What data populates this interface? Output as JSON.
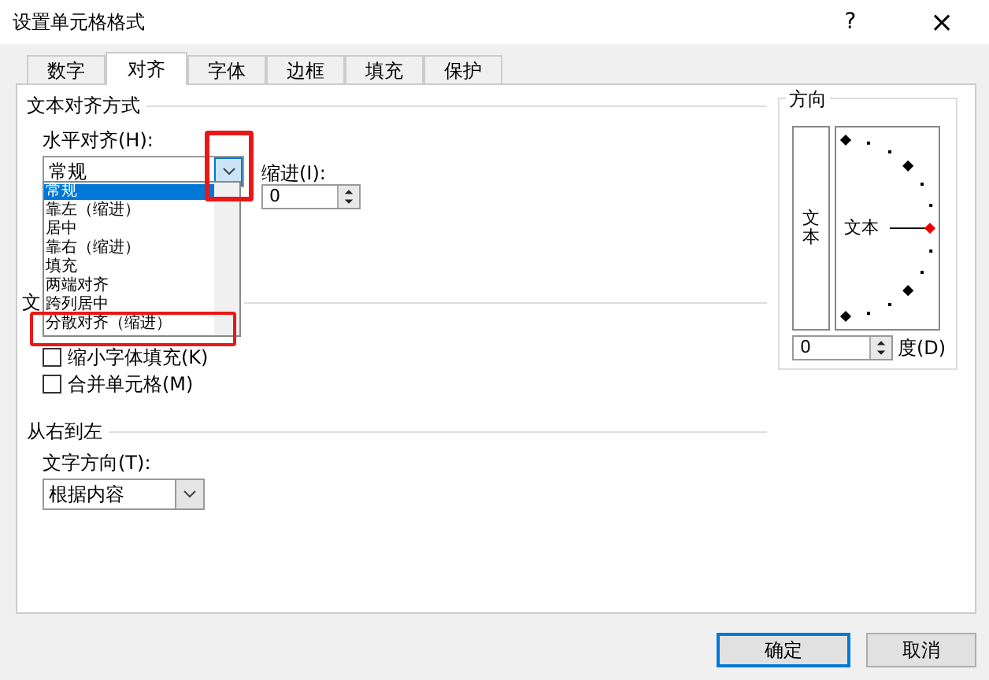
{
  "window": {
    "title": "设置单元格格式",
    "help": "?",
    "close": "×"
  },
  "tabs": [
    {
      "label": "数字",
      "selected": false
    },
    {
      "label": "对齐",
      "selected": true
    },
    {
      "label": "字体",
      "selected": false
    },
    {
      "label": "边框",
      "selected": false
    },
    {
      "label": "填充",
      "selected": false
    },
    {
      "label": "保护",
      "selected": false
    }
  ],
  "alignment": {
    "title": "文本对齐方式",
    "horizontal_label": "水平对齐(H):",
    "horizontal_value": "常规",
    "indent_label": "缩进(I):",
    "indent_value": "0",
    "dropdown": [
      {
        "label": "常规",
        "selected": true
      },
      {
        "label": "靠左（缩进）",
        "selected": false
      },
      {
        "label": "居中",
        "selected": false
      },
      {
        "label": "靠右（缩进）",
        "selected": false
      },
      {
        "label": "填充",
        "selected": false
      },
      {
        "label": "两端对齐",
        "selected": false
      },
      {
        "label": "跨列居中",
        "selected": false
      },
      {
        "label": "分散对齐（缩进）",
        "selected": false
      }
    ]
  },
  "text_control": {
    "title": "文",
    "options": [
      {
        "label": "缩小字体填充(K)",
        "checked": false
      },
      {
        "label": "合并单元格(M)",
        "checked": false
      }
    ]
  },
  "rtl": {
    "title": "从右到左",
    "direction_label": "文字方向(T):",
    "direction_value": "根据内容"
  },
  "orientation": {
    "title": "方向",
    "vertical_text": "文本",
    "dial_text": "文本",
    "degrees_value": "0",
    "degrees_label": "度(D)"
  },
  "buttons": [
    "确定",
    "取消"
  ]
}
